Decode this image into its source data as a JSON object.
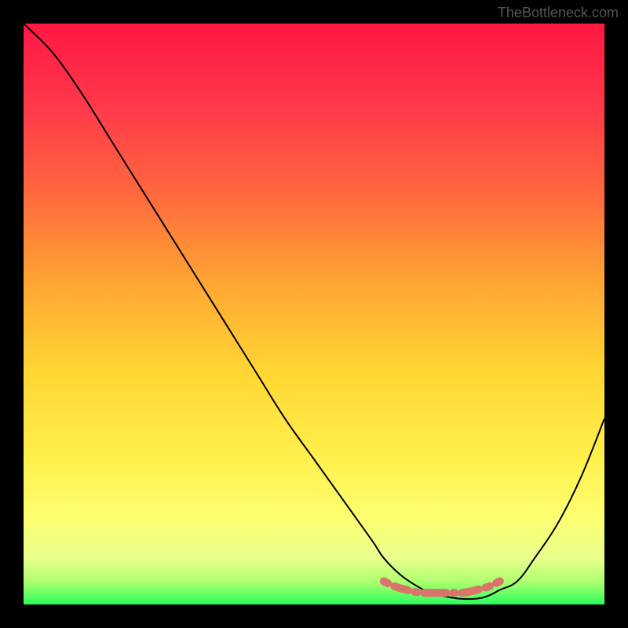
{
  "watermark": "TheBottleneck.com",
  "chart_data": {
    "type": "line",
    "title": "",
    "xlabel": "",
    "ylabel": "",
    "xlim": [
      0,
      100
    ],
    "ylim": [
      0,
      100
    ],
    "series": [
      {
        "name": "bottleneck-curve",
        "x": [
          0,
          5,
          10,
          15,
          20,
          25,
          30,
          35,
          40,
          45,
          50,
          55,
          60,
          62,
          65,
          68,
          70,
          72,
          75,
          78,
          80,
          82,
          85,
          88,
          92,
          96,
          100
        ],
        "y": [
          100,
          95,
          88,
          80,
          72,
          64,
          56,
          48,
          40,
          32,
          25,
          18,
          11,
          8,
          5,
          3,
          2,
          1.5,
          1,
          1,
          1.5,
          2.5,
          4,
          8,
          14,
          22,
          32
        ]
      },
      {
        "name": "optimal-zone-marker",
        "x": [
          62,
          64,
          66,
          68,
          70,
          72,
          74,
          76,
          78,
          80,
          82
        ],
        "y": [
          4,
          3,
          2.5,
          2,
          2,
          2,
          2,
          2,
          2.5,
          3,
          4
        ]
      }
    ],
    "gradient_stops": [
      {
        "offset": 0,
        "color": "#ff1744"
      },
      {
        "offset": 15,
        "color": "#ff3b4a"
      },
      {
        "offset": 30,
        "color": "#ff6b3d"
      },
      {
        "offset": 45,
        "color": "#ffa733"
      },
      {
        "offset": 60,
        "color": "#ffd633"
      },
      {
        "offset": 75,
        "color": "#fff04d"
      },
      {
        "offset": 85,
        "color": "#fdff70"
      },
      {
        "offset": 92,
        "color": "#e8ff8c"
      },
      {
        "offset": 96,
        "color": "#b0ff70"
      },
      {
        "offset": 100,
        "color": "#2cff5c"
      }
    ],
    "marker_color": "#d9736b",
    "curve_color": "#000000"
  }
}
